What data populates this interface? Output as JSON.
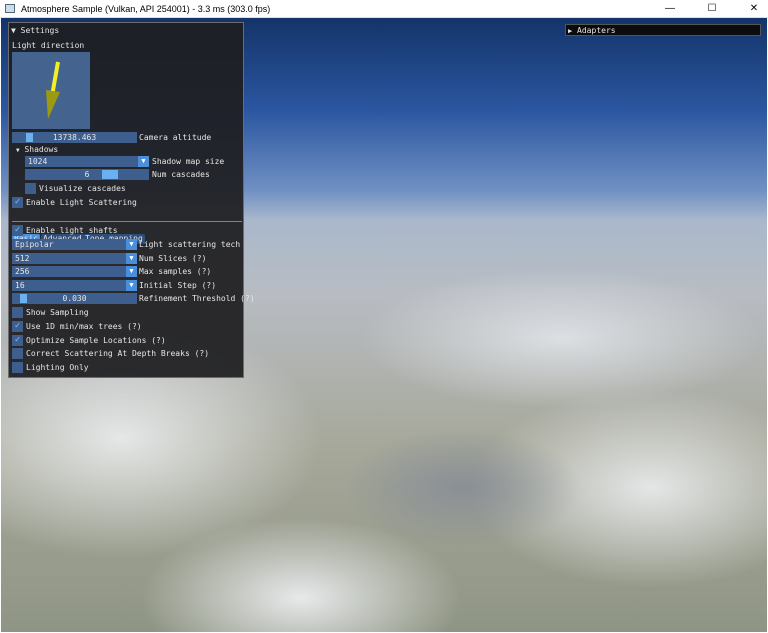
{
  "window": {
    "title": "Atmosphere Sample (Vulkan, API 254001) - 3.3 ms (303.0 fps)",
    "minimize": "—",
    "maximize": "☐",
    "close": "✕"
  },
  "settings": {
    "header": "Settings",
    "light_direction_label": "Light direction",
    "camera_altitude": {
      "value": "13738.463",
      "label": "Camera altitude",
      "fraction": 0.12
    },
    "shadows": {
      "header": "Shadows",
      "shadow_map_size": {
        "value": "1024",
        "label": "Shadow map size"
      },
      "num_cascades": {
        "value": "6",
        "label": "Num cascades",
        "fraction": 0.75
      },
      "visualize_cascades": {
        "label": "Visualize cascades",
        "checked": false
      }
    },
    "enable_light_scattering": {
      "label": "Enable Light Scattering",
      "checked": true
    },
    "tabs": [
      {
        "label": "Basic",
        "active": true
      },
      {
        "label": "Advanced",
        "active": false
      },
      {
        "label": "Tone mapping",
        "active": false
      }
    ],
    "enable_light_shafts": {
      "label": "Enable light shafts",
      "checked": true
    },
    "light_scattering_tech": {
      "value": "Epipolar",
      "label": "Light scattering tech"
    },
    "num_slices": {
      "value": "512",
      "label": "Num Slices (?)"
    },
    "max_samples": {
      "value": "256",
      "label": "Max samples (?)"
    },
    "initial_step": {
      "value": "16",
      "label": "Initial Step (?)"
    },
    "refinement_threshold": {
      "value": "0.030",
      "label": "Refinement Threshold (?)",
      "fraction": 0.03
    },
    "checkboxes": [
      {
        "label": "Show Sampling",
        "checked": false
      },
      {
        "label": "Use 1D min/max trees (?)",
        "checked": true
      },
      {
        "label": "Optimize Sample Locations (?)",
        "checked": true
      },
      {
        "label": "Correct Scattering At Depth Breaks (?)",
        "checked": false
      },
      {
        "label": "Lighting Only",
        "checked": false
      }
    ]
  },
  "adapters": {
    "header": "Adapters"
  },
  "icons": {
    "expanded": "▼",
    "collapsed": "▶",
    "combo_arrow": "▼",
    "check": "✓"
  }
}
